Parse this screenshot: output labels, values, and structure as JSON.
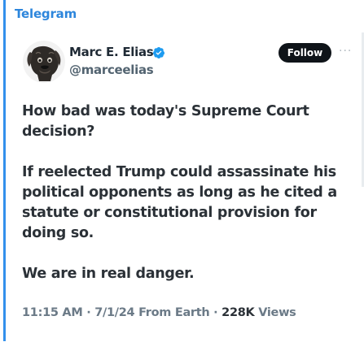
{
  "source": {
    "label": "Telegram"
  },
  "author": {
    "display_name": "Marc E. Elias",
    "handle": "@marceelias",
    "verified": true
  },
  "follow_button": {
    "label": "Follow"
  },
  "more_menu": {
    "label": "···"
  },
  "tweet": {
    "paragraphs": [
      "How bad was today's Supreme Court decision?",
      "If reelected Trump could assassinate his political opponents as long as he cited a statute or constitutional provision for doing so.",
      "We are in real danger."
    ]
  },
  "meta": {
    "time": "11:15 AM",
    "sep1": " · ",
    "date": "7/1/24",
    "from": " From Earth",
    "sep2": " · ",
    "views_count": "228K",
    "views_label": " Views"
  },
  "colors": {
    "accent": "#3390ec",
    "verified": "#1d9bf0",
    "follow_bg": "#0f1419"
  }
}
